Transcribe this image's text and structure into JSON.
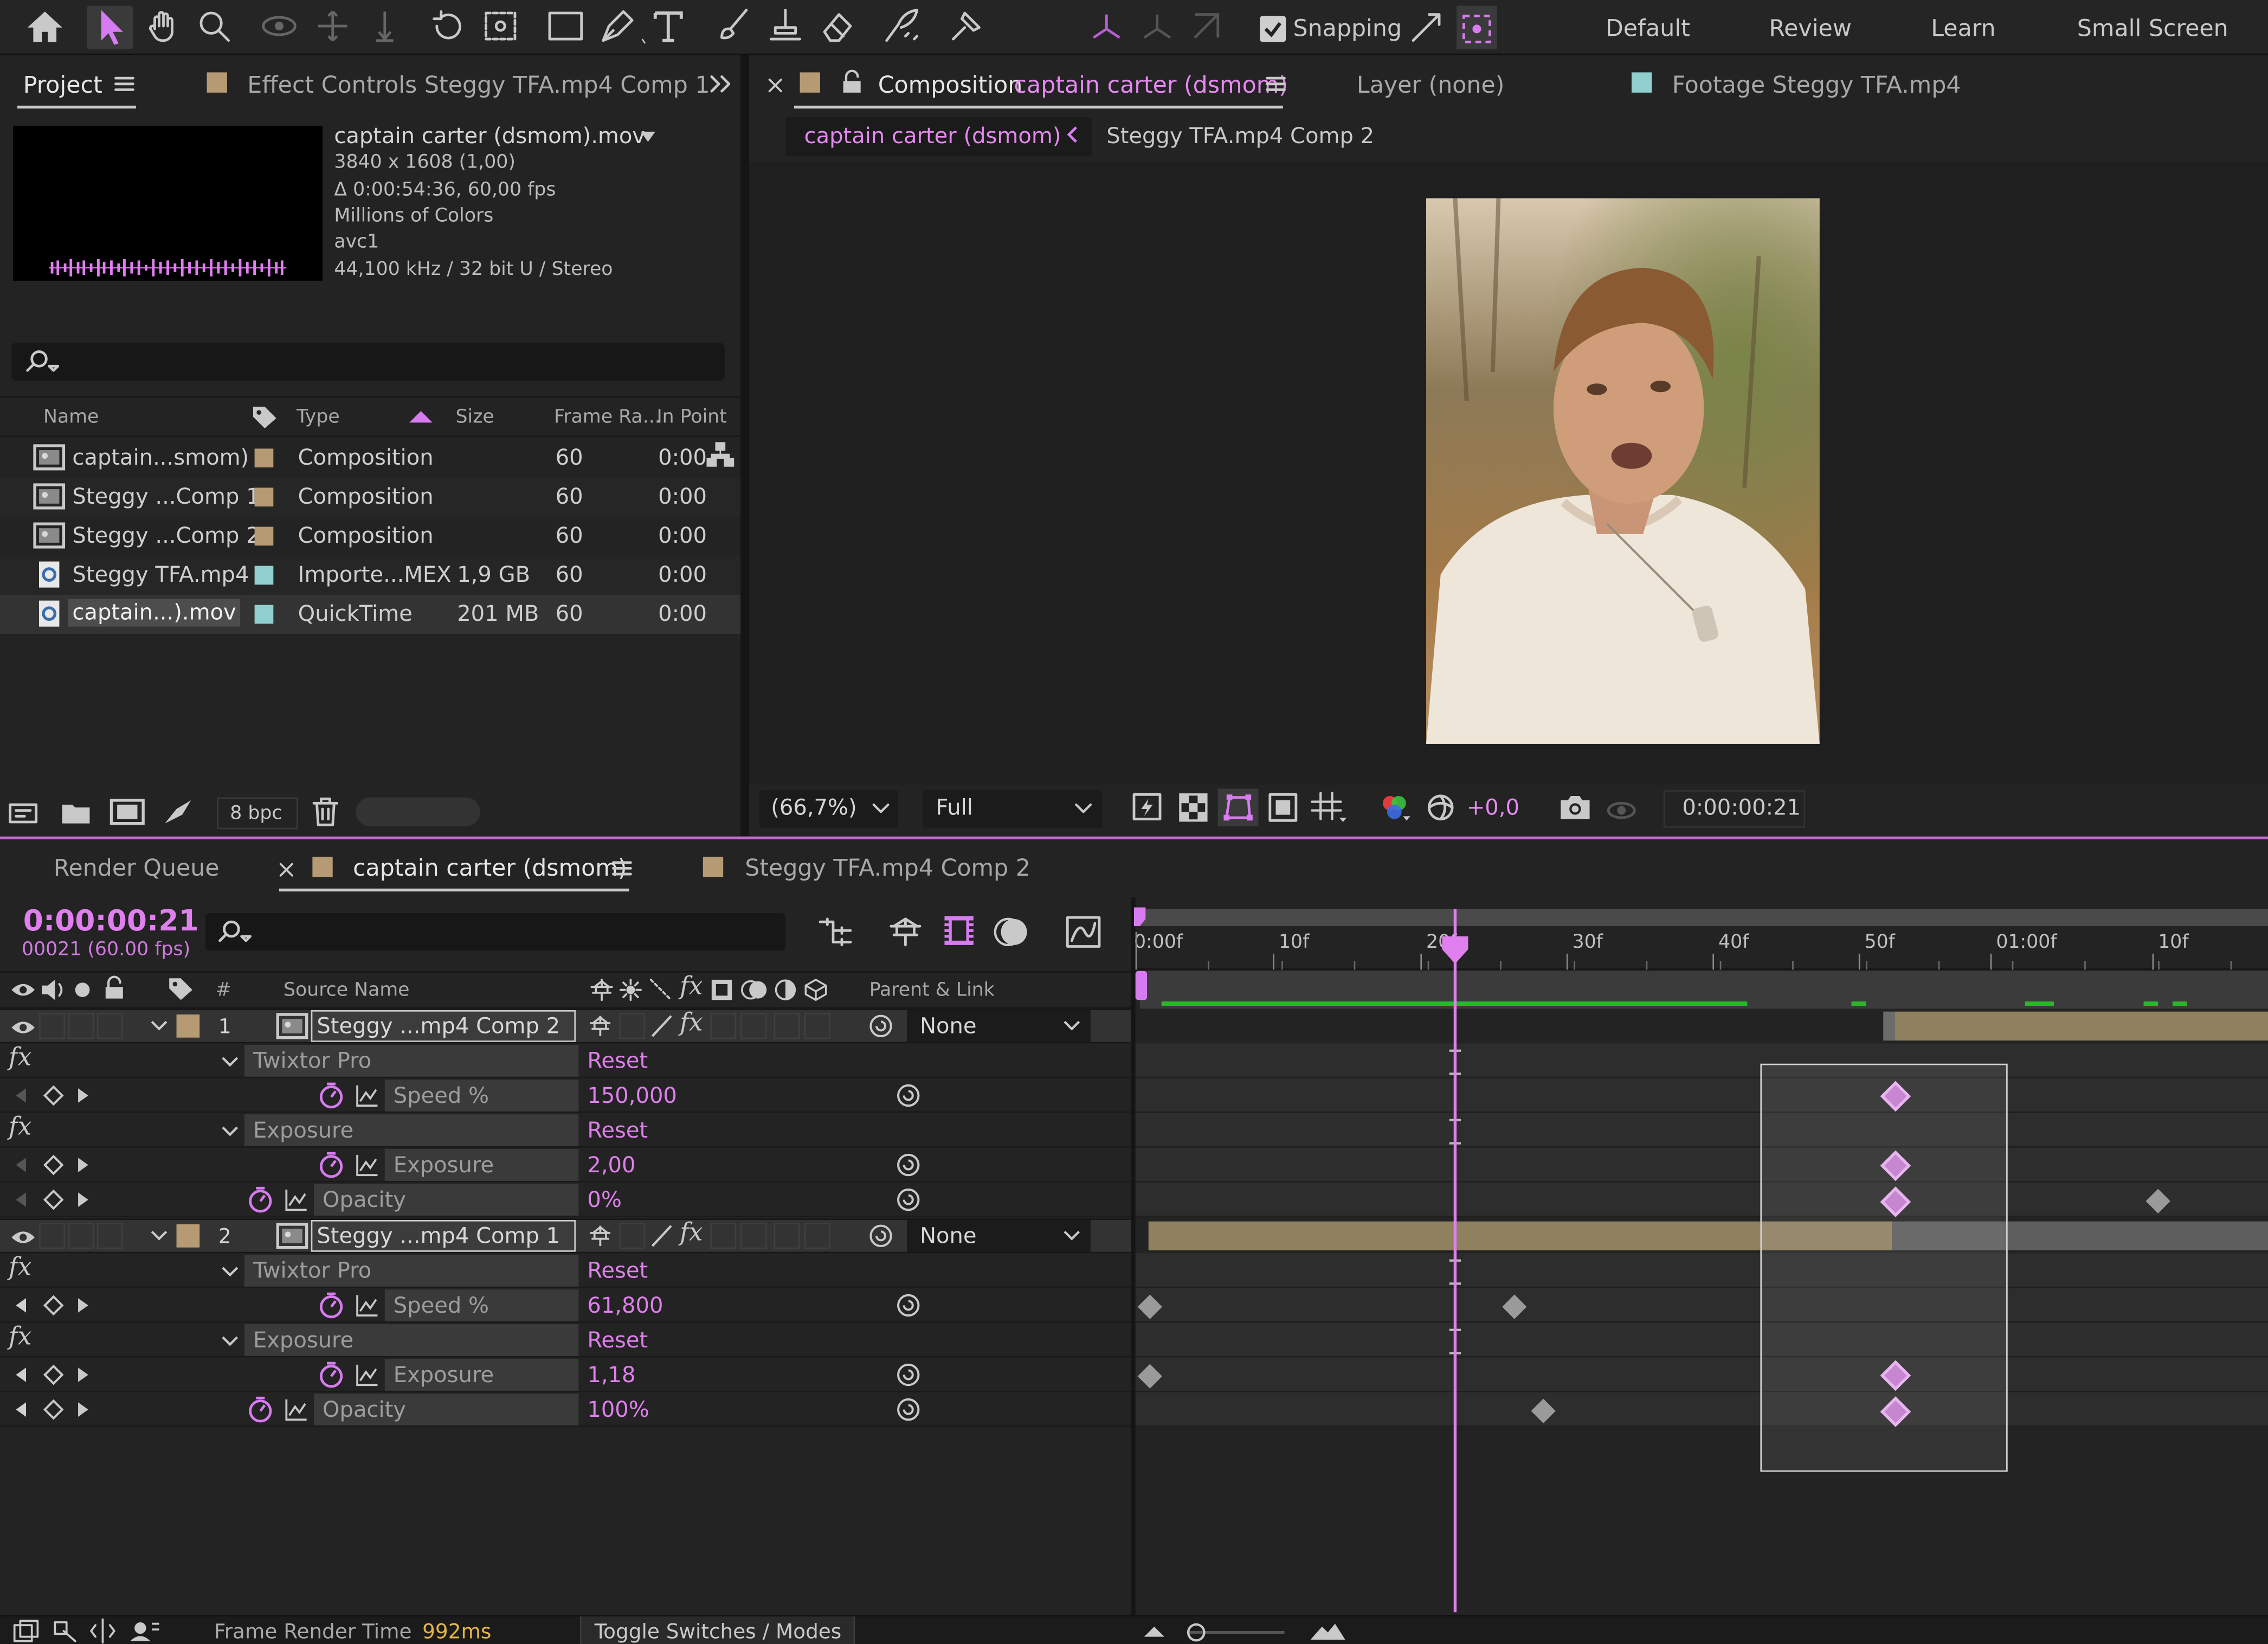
{
  "toolbar": {
    "snapping": "Snapping",
    "workspaces": [
      "Default",
      "Review",
      "Learn",
      "Small Screen"
    ]
  },
  "project_panel": {
    "tab": "Project",
    "effect_controls": "Effect Controls Steggy TFA.mp4 Comp 1",
    "info": {
      "name": "captain carter (dsmom).mov",
      "size": "3840 x 1608 (1,00)",
      "duration": "Δ 0:00:54:36, 60,00 fps",
      "colors": "Millions of Colors",
      "codec": "avc1",
      "audio": "44,100 kHz / 32 bit U / Stereo"
    },
    "columns": [
      "Name",
      "Type",
      "Size",
      "Frame Ra...",
      "In Point"
    ],
    "items": [
      {
        "name": "captain...smom)",
        "type": "Composition",
        "size": "",
        "fps": "60",
        "in": "0:00",
        "color": "#b59a74"
      },
      {
        "name": "Steggy ...Comp 1",
        "type": "Composition",
        "size": "",
        "fps": "60",
        "in": "0:00",
        "color": "#b59a74"
      },
      {
        "name": "Steggy ...Comp 2",
        "type": "Composition",
        "size": "",
        "fps": "60",
        "in": "0:00",
        "color": "#b59a74"
      },
      {
        "name": "Steggy TFA.mp4",
        "type": "Importe...MEX",
        "size": "1,9 GB",
        "fps": "60",
        "in": "0:00",
        "color": "#8fd0cf"
      },
      {
        "name": "captain...).mov",
        "type": "QuickTime",
        "size": "201 MB",
        "fps": "60",
        "in": "0:00",
        "color": "#8fd0cf"
      }
    ],
    "bpc": "8 bpc"
  },
  "comp_panel": {
    "tab_prefix": "Composition",
    "tab_name": "captain carter (dsmom)",
    "layer_tab": "Layer (none)",
    "footage_tab": "Footage Steggy TFA.mp4",
    "breadcrumb": [
      "captain carter (dsmom)",
      "Steggy TFA.mp4 Comp 2"
    ],
    "zoom": "(66,7%)",
    "resolution": "Full",
    "exposure": "+0,0",
    "timecode": "0:00:00:21"
  },
  "timeline": {
    "tabs": [
      "Render Queue",
      "captain carter (dsmom)",
      "Steggy TFA.mp4 Comp 2"
    ],
    "timecode": "0:00:00:21",
    "frame_info": "00021 (60.00 fps)",
    "col_source": "Source Name",
    "col_parent": "Parent & Link",
    "col_num": "#",
    "ruler": [
      "0:00f",
      "10f",
      "20f",
      "30f",
      "40f",
      "50f",
      "01:00f",
      "10f"
    ],
    "layers": [
      {
        "num": "1",
        "name": "Steggy ...mp4 Comp 2",
        "parent": "None"
      },
      {
        "num": "2",
        "name": "Steggy ...mp4 Comp 1",
        "parent": "None"
      }
    ],
    "props": {
      "twixtor": "Twixtor Pro",
      "exposure_fx": "Exposure",
      "reset": "Reset",
      "speed": "Speed %",
      "exposure": "Exposure",
      "opacity": "Opacity",
      "l1_speed": "150,000",
      "l1_exposure": "2,00",
      "l1_opacity": "0%",
      "l2_speed": "61,800",
      "l2_exposure": "1,18",
      "l2_opacity": "100%"
    },
    "footer": {
      "label": "Frame Render Time",
      "value": "992ms",
      "toggle": "Toggle Switches / Modes"
    }
  }
}
